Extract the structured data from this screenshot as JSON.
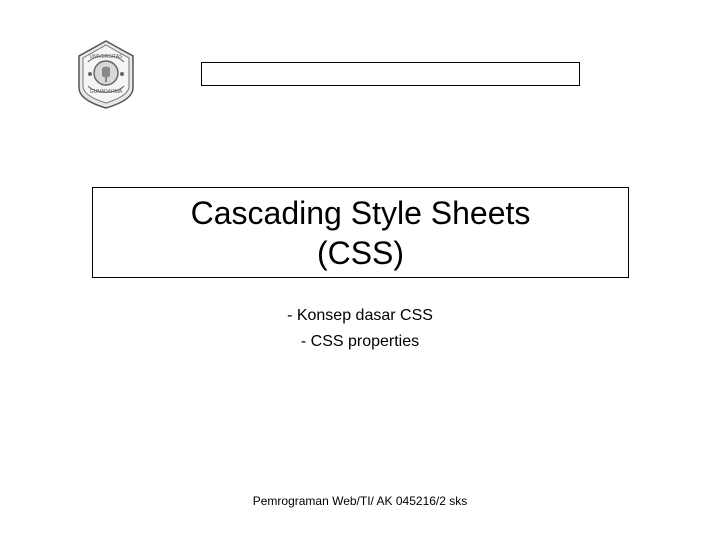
{
  "logo": {
    "top_text": "UNIVERSITAS",
    "bottom_text": "GUNADARMA"
  },
  "title": {
    "line1": "Cascading Style Sheets",
    "line2": "(CSS)"
  },
  "subtitles": {
    "item1": "- Konsep dasar CSS",
    "item2": "- CSS properties"
  },
  "footer": "Pemrograman Web/TI/ AK 045216/2 sks"
}
